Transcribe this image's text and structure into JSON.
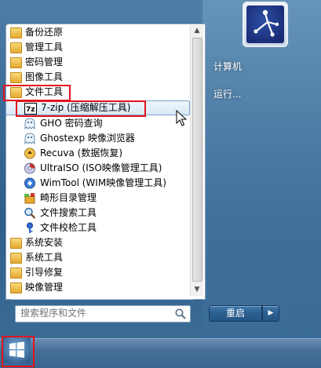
{
  "right_menu": {
    "computer": "计算机",
    "run": "运行..."
  },
  "programs": [
    {
      "type": "folder",
      "label": "备份还原",
      "icon": "folder-icon"
    },
    {
      "type": "folder",
      "label": "管理工具",
      "icon": "folder-icon"
    },
    {
      "type": "folder",
      "label": "密码管理",
      "icon": "folder-icon"
    },
    {
      "type": "folder",
      "label": "图像工具",
      "icon": "folder-icon"
    },
    {
      "type": "folder",
      "label": "文件工具",
      "icon": "folder-icon"
    },
    {
      "type": "item",
      "label": "7-zip (压缩解压工具)",
      "icon": "7zip-icon",
      "selected": true
    },
    {
      "type": "item",
      "label": "GHO 密码查询",
      "icon": "ghost-icon"
    },
    {
      "type": "item",
      "label": "Ghostexp 映像浏览器",
      "icon": "ghost-icon"
    },
    {
      "type": "item",
      "label": "Recuva (数据恢复)",
      "icon": "recuva-icon"
    },
    {
      "type": "item",
      "label": "UltraISO (ISO映像管理工具)",
      "icon": "disc-icon"
    },
    {
      "type": "item",
      "label": "WimTool (WIM映像管理工具)",
      "icon": "wim-icon"
    },
    {
      "type": "item",
      "label": "畸形目录管理",
      "icon": "box-icon"
    },
    {
      "type": "item",
      "label": "文件搜索工具",
      "icon": "magnifier-icon"
    },
    {
      "type": "item",
      "label": "文件校检工具",
      "icon": "key-icon"
    },
    {
      "type": "folder",
      "label": "系统安装",
      "icon": "folder-icon"
    },
    {
      "type": "folder",
      "label": "系统工具",
      "icon": "folder-icon"
    },
    {
      "type": "folder",
      "label": "引导修复",
      "icon": "folder-icon"
    },
    {
      "type": "folder",
      "label": "映像管理",
      "icon": "folder-icon"
    }
  ],
  "search": {
    "placeholder": "搜索程序和文件"
  },
  "power": {
    "label": "重启"
  },
  "colors": {
    "highlight_box": "#e2141e",
    "selection": "#d9e8f7"
  }
}
